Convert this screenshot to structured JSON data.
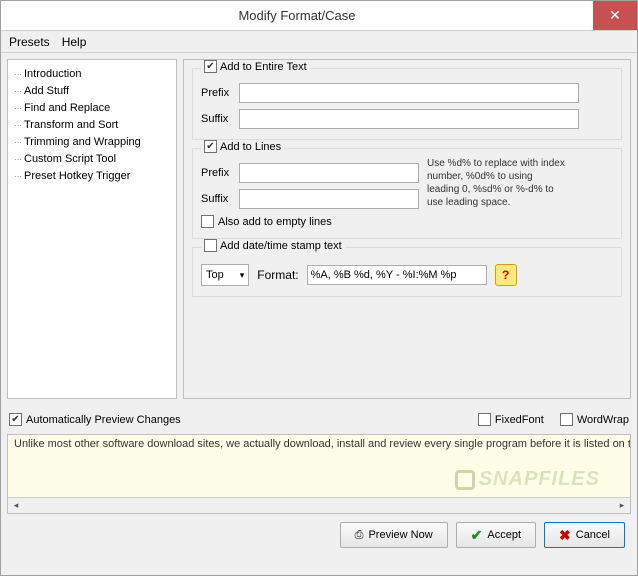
{
  "title": "Modify Format/Case",
  "menu": {
    "presets": "Presets",
    "help": "Help"
  },
  "sidebar": {
    "items": [
      {
        "label": "Introduction"
      },
      {
        "label": "Add Stuff"
      },
      {
        "label": "Find and Replace"
      },
      {
        "label": "Transform and Sort"
      },
      {
        "label": "Trimming and Wrapping"
      },
      {
        "label": "Custom Script Tool"
      },
      {
        "label": "Preset Hotkey Trigger"
      }
    ]
  },
  "group1": {
    "label": "Add to Entire Text",
    "prefix_label": "Prefix",
    "suffix_label": "Suffix",
    "prefix": "",
    "suffix": ""
  },
  "group2": {
    "label": "Add to Lines",
    "prefix_label": "Prefix",
    "suffix_label": "Suffix",
    "prefix": "",
    "suffix": "",
    "hint": "Use %d% to replace with index number, %0d% to using leading 0, %sd% or %-d% to use leading space.",
    "empty_label": "Also add to empty lines"
  },
  "group3": {
    "label": "Add date/time stamp text",
    "position": "Top",
    "format_label": "Format:",
    "format_value": "%A, %B %d, %Y - %I:%M %p"
  },
  "options": {
    "auto_preview": "Automatically Preview Changes",
    "fixedfont": "FixedFont",
    "wordwrap": "WordWrap"
  },
  "preview": {
    "text": "Unlike most other software download sites, we actually download, install and review every single program before it is listed on the sit",
    "watermark": "SNAPFILES"
  },
  "buttons": {
    "preview": "Preview Now",
    "accept": "Accept",
    "cancel": "Cancel"
  }
}
